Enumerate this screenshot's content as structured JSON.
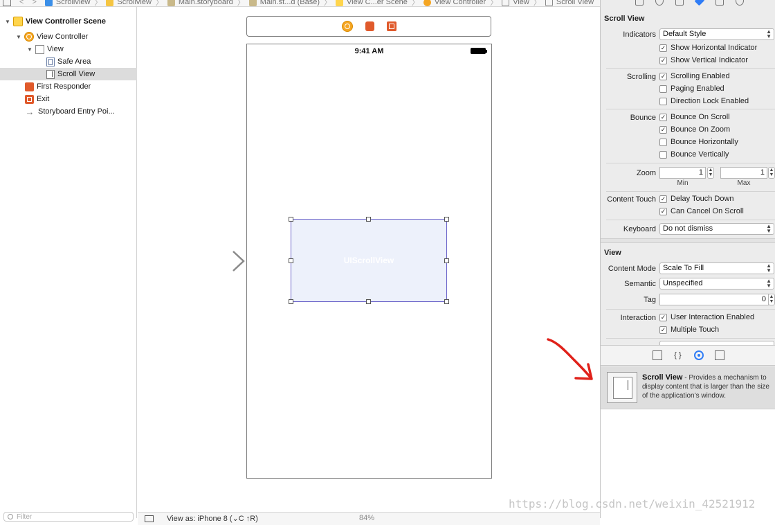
{
  "breadcrumbs": [
    "Scrollview",
    "Scrollview",
    "Main.storyboard",
    "Main.st...d (Base)",
    "View C...er Scene",
    "View Controller",
    "View",
    "Scroll View"
  ],
  "outline": {
    "items": [
      {
        "label": "View Controller Scene",
        "icon": "scene-icon"
      },
      {
        "label": "View Controller",
        "icon": "view-controller-icon"
      },
      {
        "label": "View",
        "icon": "view-icon"
      },
      {
        "label": "Safe Area",
        "icon": "safe-area-icon"
      },
      {
        "label": "Scroll View",
        "icon": "scroll-view-icon"
      },
      {
        "label": "First Responder",
        "icon": "first-responder-icon"
      },
      {
        "label": "Exit",
        "icon": "exit-icon"
      },
      {
        "label": "Storyboard Entry Poi...",
        "icon": "entry-point-icon"
      }
    ],
    "filter_placeholder": "Filter"
  },
  "canvas": {
    "status_time": "9:41 AM",
    "scroll_view_label": "UIScrollView",
    "view_as": "View as: iPhone 8 (⌄C ↑R)",
    "zoom": "84%"
  },
  "inspector": {
    "scroll_view_title": "Scroll View",
    "indicators_label": "Indicators",
    "indicators_value": "Default Style",
    "show_horizontal": "Show Horizontal Indicator",
    "show_vertical": "Show Vertical Indicator",
    "scrolling_label": "Scrolling",
    "scrolling_enabled": "Scrolling Enabled",
    "paging_enabled": "Paging Enabled",
    "direction_lock": "Direction Lock Enabled",
    "bounce_label": "Bounce",
    "bounce_on_scroll": "Bounce On Scroll",
    "bounce_on_zoom": "Bounce On Zoom",
    "bounce_horizontally": "Bounce Horizontally",
    "bounce_vertically": "Bounce Vertically",
    "zoom_label": "Zoom",
    "zoom_min": "1",
    "zoom_max": "1",
    "min_label": "Min",
    "max_label": "Max",
    "content_touch_label": "Content Touch",
    "delay_touch_down": "Delay Touch Down",
    "can_cancel": "Can Cancel On Scroll",
    "keyboard_label": "Keyboard",
    "keyboard_value": "Do not dismiss",
    "view_title": "View",
    "content_mode_label": "Content Mode",
    "content_mode_value": "Scale To Fill",
    "semantic_label": "Semantic",
    "semantic_value": "Unspecified",
    "tag_label": "Tag",
    "tag_value": "0",
    "interaction_label": "Interaction",
    "user_interaction": "User Interaction Enabled",
    "multiple_touch": "Multiple Touch"
  },
  "library": {
    "item_title": "Scroll View",
    "item_desc": " - Provides a mechanism to display content that is larger than the size of the application’s window."
  },
  "watermark": "https://blog.csdn.net/weixin_42521912",
  "colors": {
    "accent": "#2f7cf6",
    "selection": "#6b63c9",
    "annotation": "#e0211a"
  }
}
